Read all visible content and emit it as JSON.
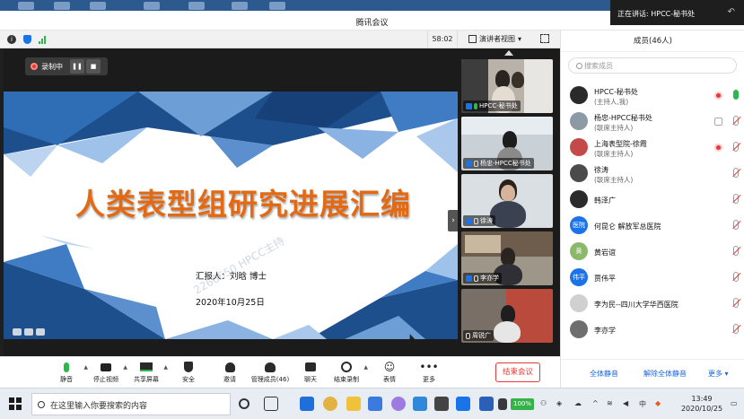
{
  "window": {
    "title": "腾讯会议",
    "speaking_prefix": "正在讲话: ",
    "speaking_name": "HPCC-秘书处"
  },
  "video_bar": {
    "timer": "58:02",
    "view_label": "演讲者视图"
  },
  "recording": {
    "label": "录制中"
  },
  "slide": {
    "title": "人类表型组研究进展汇编",
    "reporter": "汇报人：刘晗 博士",
    "date": "2020年10月25日",
    "watermark": "2266650 HPCC主持"
  },
  "thumbnails": [
    {
      "name": "HPCC-秘书处",
      "mic": "on",
      "bg": "#b8b2a8"
    },
    {
      "name": "杨忠-HPCC秘书处",
      "mic": "off",
      "bg": "#c9d0d6"
    },
    {
      "name": "徐涛",
      "mic": "off",
      "bg": "#d9dfe3"
    },
    {
      "name": "李亦学",
      "mic": "off",
      "bg": "#9e9688"
    },
    {
      "name": "周锐广",
      "mic": "off",
      "bg": "#7a6f66"
    }
  ],
  "toolbar": {
    "items": [
      {
        "label": "静音",
        "icon": "mic-icon"
      },
      {
        "label": "停止视频",
        "icon": "camera-icon"
      },
      {
        "label": "共享屏幕",
        "icon": "share-screen-icon"
      },
      {
        "label": "安全",
        "icon": "shield-icon"
      },
      {
        "label": "邀请",
        "icon": "invite-icon"
      },
      {
        "label": "管理成员(46)",
        "icon": "members-icon"
      },
      {
        "label": "聊天",
        "icon": "chat-icon"
      },
      {
        "label": "结束录制",
        "icon": "stop-record-icon"
      },
      {
        "label": "表情",
        "icon": "emoji-icon"
      },
      {
        "label": "更多",
        "icon": "more-icon"
      }
    ],
    "end_label": "结束会议"
  },
  "panel": {
    "title": "成员(46人)",
    "search_placeholder": "搜索成员",
    "members": [
      {
        "name": "HPCC-秘书处",
        "sub": "(主持人,我)",
        "avatar": "",
        "color": "#2a2a2a",
        "rec": "red",
        "mic": "on"
      },
      {
        "name": "杨忠-HPCC秘书处",
        "sub": "(联席主持人)",
        "avatar": "",
        "color": "#8c9aa6",
        "rec": "grey",
        "mic": "off"
      },
      {
        "name": "上海表型院-徐霞",
        "sub": "(联席主持人)",
        "avatar": "",
        "color": "#c44a4a",
        "rec": "red",
        "mic": "off"
      },
      {
        "name": "徐涛",
        "sub": "(联席主持人)",
        "avatar": "",
        "color": "#4b4b4b",
        "rec": "",
        "mic": "off"
      },
      {
        "name": "韩泽广",
        "sub": "",
        "avatar": "",
        "color": "#2b2b2b",
        "rec": "",
        "mic": "off"
      },
      {
        "name": "何昆仑 解放军总医院",
        "sub": "",
        "avatar": "医院",
        "color": "#1a73e8",
        "rec": "",
        "mic": "off"
      },
      {
        "name": "黄岩谊",
        "sub": "",
        "avatar": "黄",
        "color": "#8bb86a",
        "rec": "",
        "mic": "off"
      },
      {
        "name": "贾伟平",
        "sub": "",
        "avatar": "伟平",
        "color": "#1a73e8",
        "rec": "",
        "mic": "off"
      },
      {
        "name": "李为民--四川大学华西医院",
        "sub": "",
        "avatar": "",
        "color": "#d0d0d0",
        "rec": "",
        "mic": "off"
      },
      {
        "name": "李亦学",
        "sub": "",
        "avatar": "",
        "color": "#6e6e6e",
        "rec": "",
        "mic": "off"
      }
    ],
    "mute_all": "全体静音",
    "unmute_all": "解除全体静音",
    "more": "更多"
  },
  "taskbar": {
    "search_placeholder": "在这里输入你要搜索的内容",
    "battery": "100%",
    "ime": "中",
    "time": "13:49",
    "date": "2020/10/25"
  }
}
